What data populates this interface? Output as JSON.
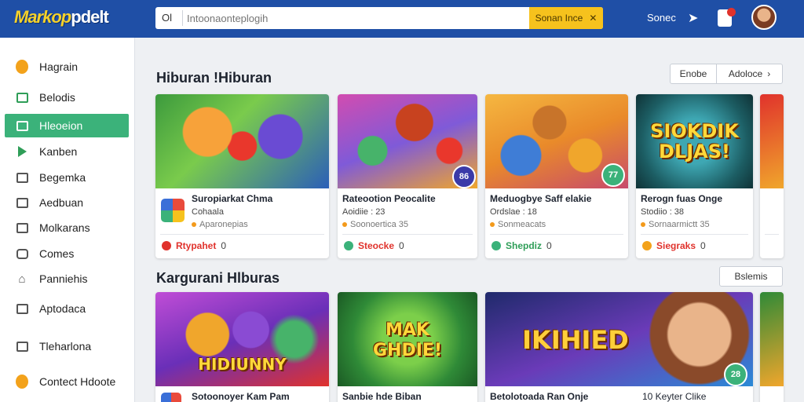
{
  "header": {
    "logo_a": "Markop",
    "logo_b": "pdelt",
    "search_icon": "Ol",
    "search_placeholder": "Intoonaonteplogih",
    "search_button": "Sonan Ince",
    "search_clear_icon": "✕",
    "link": "Sonec",
    "share_icon": "share-icon",
    "notification_icon": "bell-icon"
  },
  "sidebar": {
    "items": [
      {
        "label": "Hagrain",
        "icon": "coin-icon",
        "active": false
      },
      {
        "label": "Belodis",
        "icon": "bag-icon",
        "active": false
      },
      {
        "label": "Hleoeion",
        "icon": "check-square-icon",
        "active": true
      },
      {
        "label": "Kanben",
        "icon": "play-icon",
        "active": false
      },
      {
        "label": "Begemka",
        "icon": "checkbox-icon",
        "active": false
      },
      {
        "label": "Aedbuan",
        "icon": "mail-icon",
        "active": false
      },
      {
        "label": "Molkarans",
        "icon": "grid-icon",
        "active": false
      },
      {
        "label": "Comes",
        "icon": "tablet-icon",
        "active": false
      },
      {
        "label": "Panniehis",
        "icon": "home-icon",
        "active": false
      },
      {
        "label": "Aptodaca",
        "icon": "edit-icon",
        "active": false
      },
      {
        "label": "Tleharlona",
        "icon": "folder-icon",
        "active": false
      },
      {
        "label": "Contect Hdoote",
        "icon": "coin-icon",
        "active": false
      }
    ]
  },
  "section1": {
    "title": "Hiburan !Hiburan",
    "btn_left": "Enobe",
    "btn_right": "Adoloce",
    "chevron": "›",
    "cards": [
      {
        "title": "Suropiarkat Chma",
        "meta": "Cohaala",
        "sub": "Aparonepias",
        "action": "Rtypahet",
        "count": "0",
        "badge": "",
        "art": "",
        "accent": "#e0322c"
      },
      {
        "title": "Rateootion Peocalite",
        "meta": "Aoidiie : 23",
        "sub": "Soonoertica 35",
        "action": "Steocke",
        "count": "0",
        "badge": "86",
        "art": "",
        "accent": "#3bb27a"
      },
      {
        "title": "Meduogbye Saff elakie",
        "meta": "Ordslae : 18",
        "sub": "Sonmeacats",
        "action": "Shepdiz",
        "count": "0",
        "badge": "77",
        "art": "",
        "accent": "#3bb27a"
      },
      {
        "title": "Rerogn fuas Onge",
        "meta": "Stodiio : 38",
        "sub": "Sornaarmictt 35",
        "action": "Siegraks",
        "count": "0",
        "badge": "",
        "art": "SIOKDIK DLJAS!",
        "accent": "#f3a21b"
      }
    ]
  },
  "section2": {
    "title": "Kargurani Hlburas",
    "btn": "Bslemis",
    "cards": [
      {
        "title": "Sotoonoyer Kam Pam",
        "badge": "",
        "art": "HIDIUNNY"
      },
      {
        "title": "Sanbie hde Biban",
        "badge": "",
        "art": "MAK GHDIE!"
      },
      {
        "title": "Betolotoada Ran Onje",
        "extra": "10  Keyter Clike",
        "badge": "28",
        "art": "IKIHIED"
      }
    ]
  }
}
